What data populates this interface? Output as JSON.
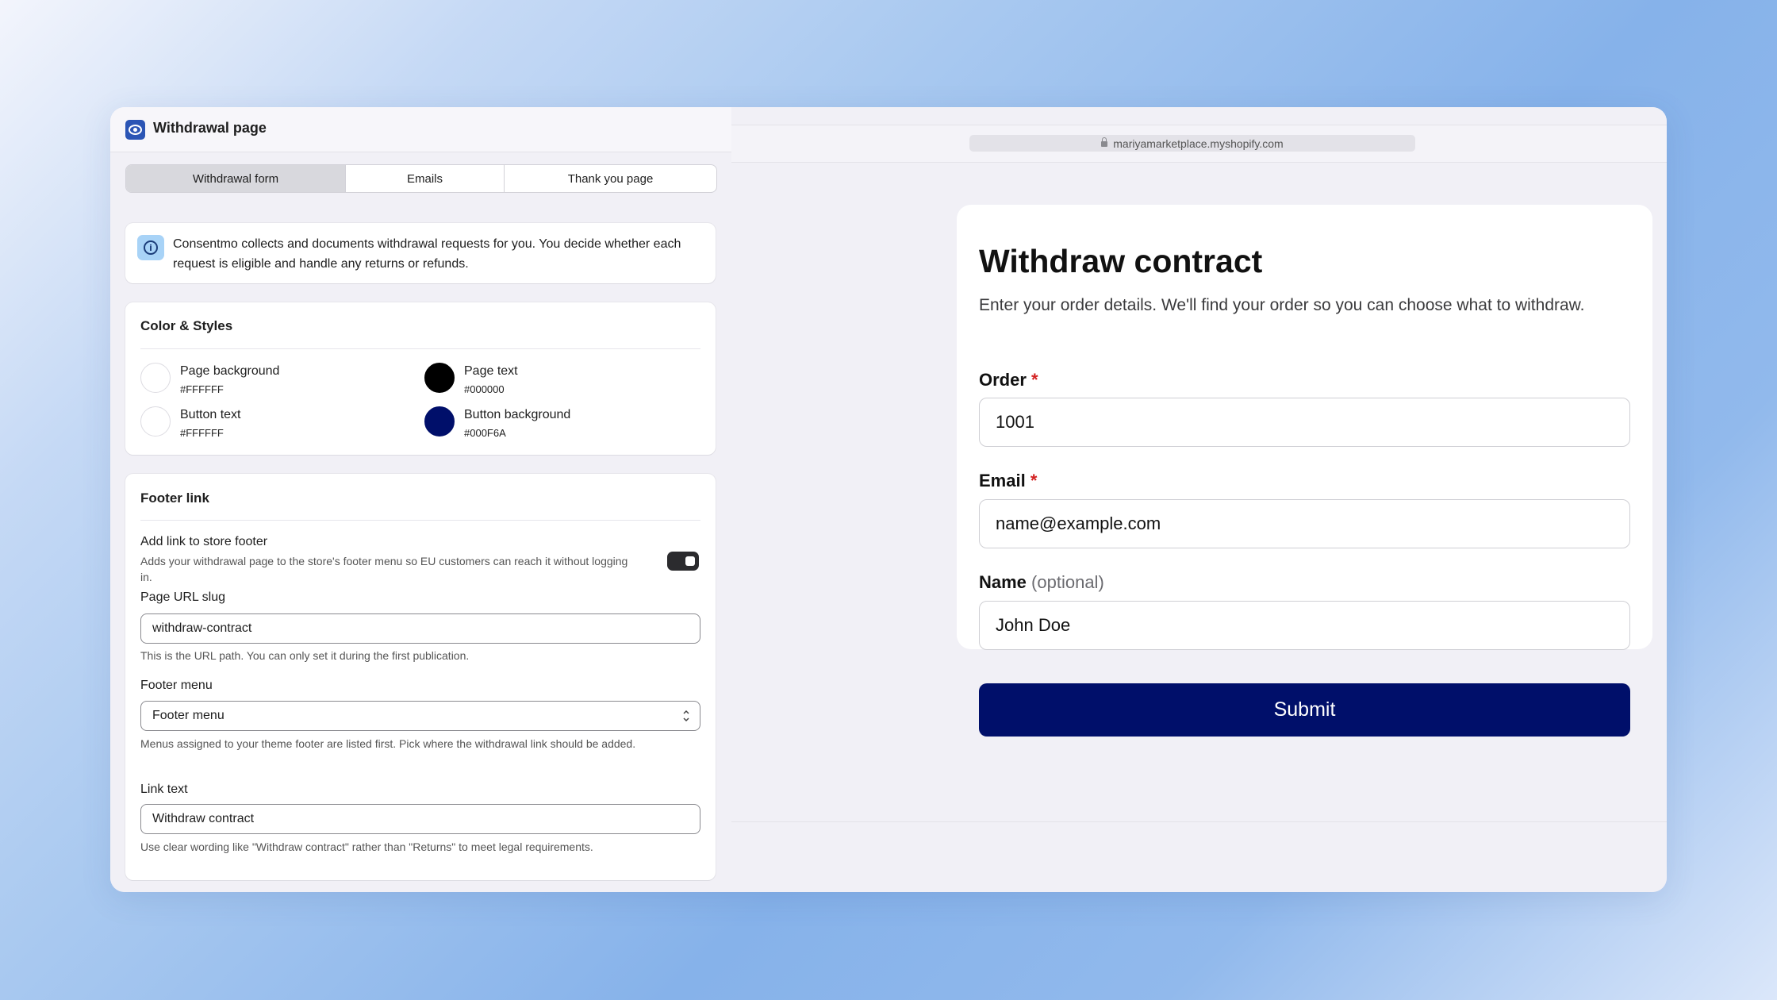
{
  "left_panel": {
    "title": "Withdrawal page",
    "tabs": [
      {
        "label": "Withdrawal form",
        "active": true
      },
      {
        "label": "Emails",
        "active": false
      },
      {
        "label": "Thank you page",
        "active": false
      }
    ],
    "info_text": "Consentmo collects and documents withdrawal requests for you. You decide whether each request is eligible and handle any returns or refunds.",
    "colors_section": {
      "title": "Color & Styles",
      "swatches": [
        {
          "name": "Page background",
          "hex": "#FFFFFF",
          "color": "#FFFFFF"
        },
        {
          "name": "Page text",
          "hex": "#000000",
          "color": "#000000"
        },
        {
          "name": "Button text",
          "hex": "#FFFFFF",
          "color": "#FFFFFF"
        },
        {
          "name": "Button background",
          "hex": "#000F6A",
          "color": "#000F6A"
        }
      ]
    },
    "footer_section": {
      "title": "Footer link",
      "toggle_label": "Add link to store footer",
      "toggle_help": "Adds your withdrawal page to the store's footer menu so EU customers can reach it without logging in.",
      "toggle_on": true,
      "slug_label": "Page URL slug",
      "slug_value": "withdraw-contract",
      "slug_help": "This is the URL path. You can only set it during the first publication.",
      "menu_label": "Footer menu",
      "menu_value": "Footer menu",
      "menu_help": "Menus assigned to your theme footer are listed first. Pick where the withdrawal link should be added.",
      "link_label": "Link text",
      "link_value": "Withdraw contract",
      "link_help": "Use clear wording like \"Withdraw contract\" rather than \"Returns\" to meet legal requirements."
    }
  },
  "preview": {
    "url": "mariyamarketplace.myshopify.com",
    "form": {
      "title": "Withdraw contract",
      "subtitle": "Enter your order details. We'll find your order so you can choose what to withdraw.",
      "order_label": "Order",
      "order_required": "*",
      "order_value": "1001",
      "email_label": "Email",
      "email_required": "*",
      "email_value": "name@example.com",
      "name_label": "Name",
      "name_optional": "(optional)",
      "name_value": "John Doe",
      "submit_label": "Submit"
    }
  },
  "colors": {
    "accent": "#2B55B5",
    "button_background": "#000F6A",
    "required": "#D32121"
  }
}
